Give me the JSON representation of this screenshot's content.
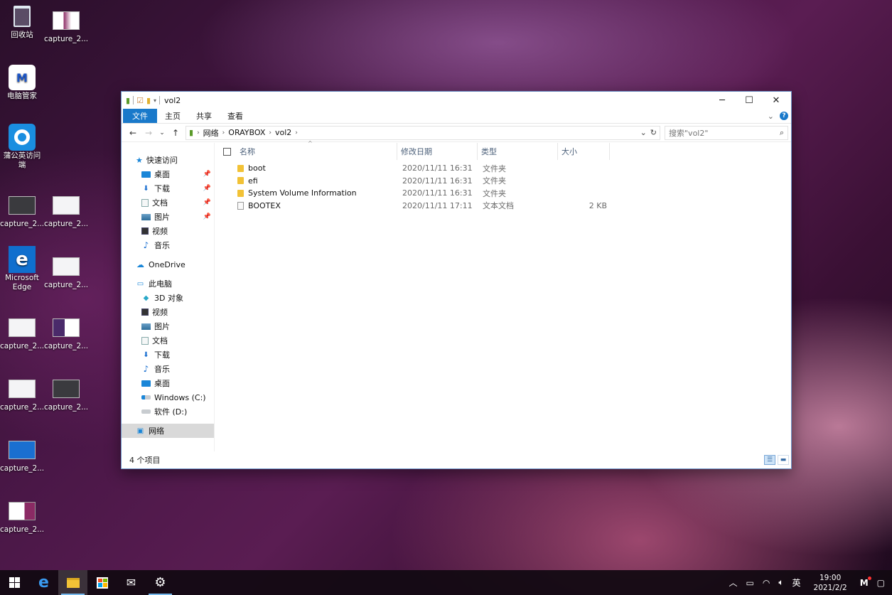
{
  "desktop": {
    "icons": [
      {
        "label": "回收站"
      },
      {
        "label": "capture_2..."
      },
      {
        "label": "电脑管家"
      },
      {
        "label": "蒲公英访问端"
      },
      {
        "label": "capture_2..."
      },
      {
        "label": "capture_2..."
      },
      {
        "label": "Microsoft Edge"
      },
      {
        "label": "capture_2..."
      },
      {
        "label": "capture_2..."
      },
      {
        "label": "capture_2..."
      },
      {
        "label": "capture_2..."
      },
      {
        "label": "capture_2..."
      },
      {
        "label": "capture_2..."
      },
      {
        "label": "capture_2..."
      }
    ]
  },
  "window": {
    "title": "vol2",
    "controls": {
      "minimize": "─",
      "maximize": "☐",
      "close": "✕"
    },
    "ribbon": {
      "tabs": [
        "文件",
        "主页",
        "共享",
        "查看"
      ],
      "expand": "⌄",
      "help": "?"
    },
    "nav": {
      "back": "←",
      "forward": "→",
      "recent": "⌄",
      "up": "↑",
      "breadcrumb": [
        "网络",
        "ORAYBOX",
        "vol2"
      ],
      "refresh": "↻",
      "history": "⌄"
    },
    "search": {
      "placeholder": "搜索\"vol2\"",
      "icon": "⌕"
    },
    "sidebar": {
      "quick_access": "快速访问",
      "quick_items": [
        "桌面",
        "下载",
        "文档",
        "图片",
        "视频",
        "音乐"
      ],
      "onedrive": "OneDrive",
      "this_pc": "此电脑",
      "pc_items": [
        "3D 对象",
        "视频",
        "图片",
        "文档",
        "下载",
        "音乐",
        "桌面",
        "Windows (C:)",
        "软件 (D:)"
      ],
      "network": "网络"
    },
    "columns": {
      "name": "名称",
      "modified": "修改日期",
      "type": "类型",
      "size": "大小"
    },
    "files": [
      {
        "name": "boot",
        "modified": "2020/11/11 16:31",
        "type": "文件夹",
        "size": ""
      },
      {
        "name": "efi",
        "modified": "2020/11/11 16:31",
        "type": "文件夹",
        "size": ""
      },
      {
        "name": "System Volume Information",
        "modified": "2020/11/11 16:31",
        "type": "文件夹",
        "size": ""
      },
      {
        "name": "BOOTEX",
        "modified": "2020/11/11 17:11",
        "type": "文本文档",
        "size": "2 KB"
      }
    ],
    "status": {
      "count": "4 个项目"
    }
  },
  "taskbar": {
    "ime": "英",
    "time": "19:00",
    "date": "2021/2/2"
  }
}
